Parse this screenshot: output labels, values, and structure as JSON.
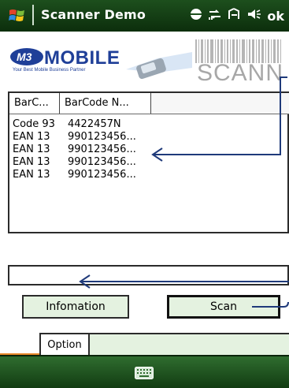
{
  "window": {
    "title": "Scanner Demo",
    "ok_label": "ok"
  },
  "banner": {
    "brand": "MOBILE",
    "tagline": "Your Best Mobile Business Partner",
    "scan_text": "SCANN"
  },
  "listview": {
    "columns": [
      "BarC...",
      "BarCode N..."
    ],
    "rows": [
      {
        "type": "Code 93",
        "code": "4422457N"
      },
      {
        "type": "EAN 13",
        "code": "990123456..."
      },
      {
        "type": "EAN 13",
        "code": "990123456..."
      },
      {
        "type": "EAN 13",
        "code": "990123456..."
      },
      {
        "type": "EAN 13",
        "code": "990123456..."
      }
    ]
  },
  "input": {
    "value": ""
  },
  "buttons": {
    "info_label": "Infomation",
    "scan_label": "Scan"
  },
  "tabs": {
    "option_label": "Option"
  },
  "colors": {
    "frame": "#e8882a",
    "button_bg": "#e4f2e0",
    "bar_green": "#1d4f1d",
    "brand_blue": "#1f3f98",
    "annotation_arrow": "#1f3a7a"
  }
}
